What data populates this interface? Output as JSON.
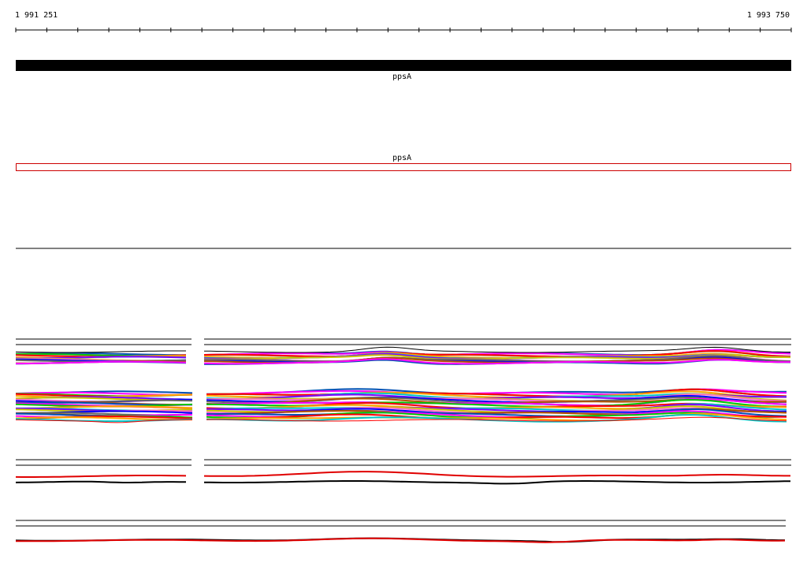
{
  "ruler": {
    "start_label": "1 991 251",
    "end_label": "1 993 750"
  },
  "genes": [
    {
      "label": "ppsA",
      "track": "filled"
    },
    {
      "label": "ppsA",
      "track": "outline"
    }
  ],
  "colors": {
    "gene_fill": "#000000",
    "gene_outline": "#cc0000",
    "line_black": "#000000",
    "line_red": "#e00000"
  },
  "palette": [
    "#0050b4",
    "#ff00ff",
    "#00c800",
    "#ff0000",
    "#ffa500",
    "#00c8c8",
    "#8000ff",
    "#c8c800",
    "#ff6ec8",
    "#0000ff",
    "#666666",
    "#b45000"
  ]
}
